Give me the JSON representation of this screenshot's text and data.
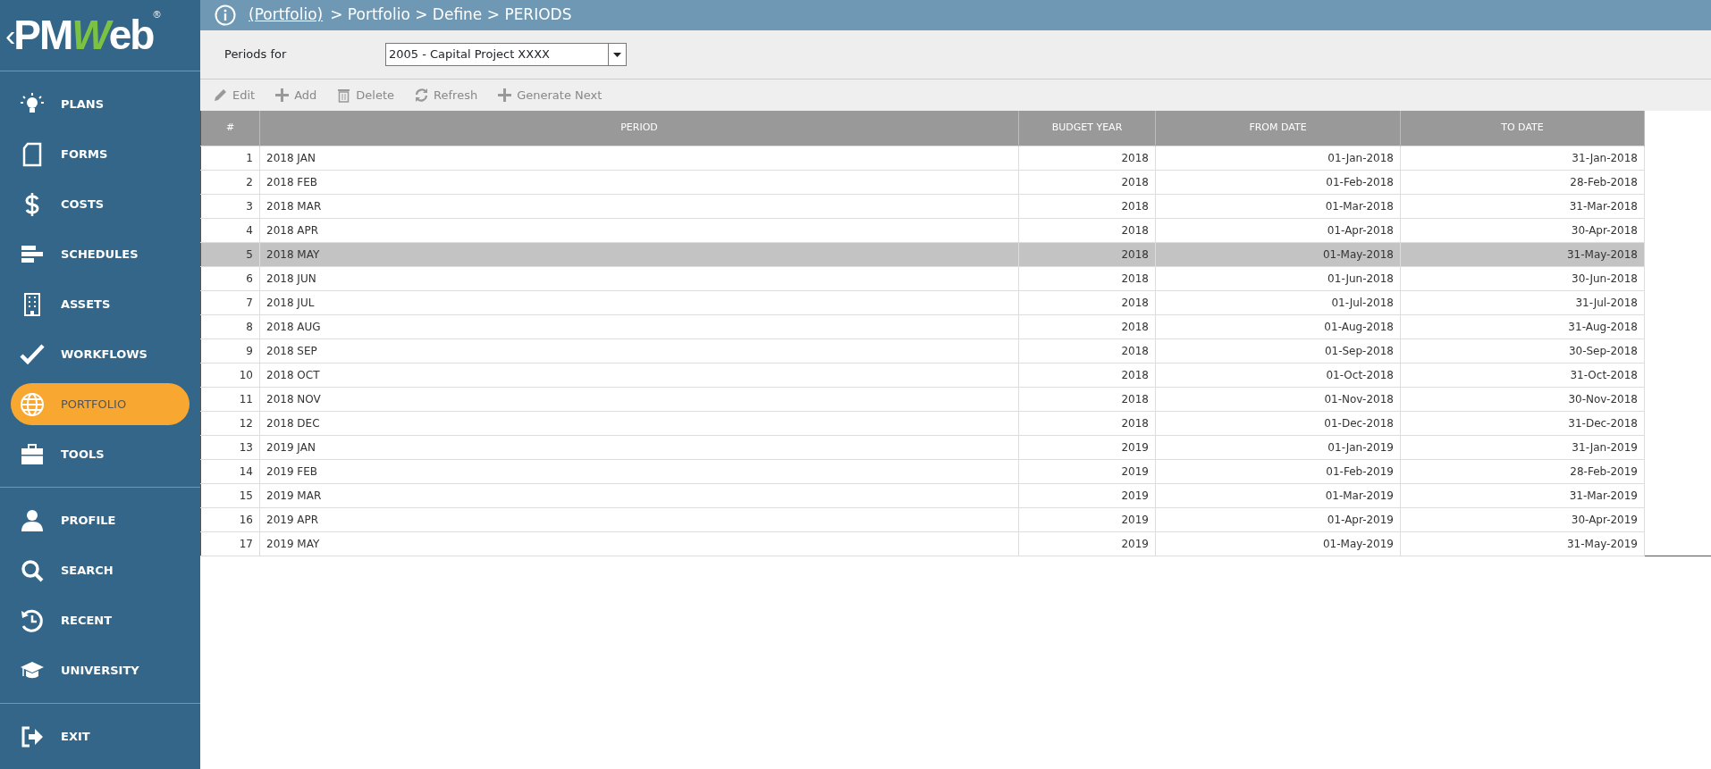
{
  "logo": {
    "prefix": "‹",
    "part_a": "PM",
    "part_b": "W",
    "part_c": "eb",
    "registered": "®"
  },
  "sidebar": {
    "groups": [
      {
        "items": [
          {
            "label": "PLANS",
            "selected": false
          },
          {
            "label": "FORMS",
            "selected": false
          },
          {
            "label": "COSTS",
            "selected": false
          },
          {
            "label": "SCHEDULES",
            "selected": false
          },
          {
            "label": "ASSETS",
            "selected": false
          },
          {
            "label": "WORKFLOWS",
            "selected": false
          },
          {
            "label": "PORTFOLIO",
            "selected": true
          },
          {
            "label": "TOOLS",
            "selected": false
          }
        ]
      },
      {
        "items": [
          {
            "label": "PROFILE",
            "selected": false
          },
          {
            "label": "SEARCH",
            "selected": false
          },
          {
            "label": "RECENT",
            "selected": false
          },
          {
            "label": "UNIVERSITY",
            "selected": false
          }
        ]
      },
      {
        "items": [
          {
            "label": "EXIT",
            "selected": false
          }
        ]
      }
    ]
  },
  "breadcrumb": {
    "link": "(Portfolio)",
    "path": "> Portfolio > Define > PERIODS"
  },
  "filter": {
    "label": "Periods for",
    "value": "2005 - Capital Project XXXX"
  },
  "toolbar": [
    {
      "label": "Edit"
    },
    {
      "label": "Add"
    },
    {
      "label": "Delete"
    },
    {
      "label": "Refresh"
    },
    {
      "label": "Generate Next"
    }
  ],
  "table": {
    "columns": [
      "#",
      "PERIOD",
      "BUDGET YEAR",
      "FROM DATE",
      "TO DATE"
    ],
    "rows": [
      {
        "cells": [
          "1",
          "2018 JAN",
          "2018",
          "01-Jan-2018",
          "31-Jan-2018"
        ],
        "selected": false
      },
      {
        "cells": [
          "2",
          "2018 FEB",
          "2018",
          "01-Feb-2018",
          "28-Feb-2018"
        ],
        "selected": false
      },
      {
        "cells": [
          "3",
          "2018 MAR",
          "2018",
          "01-Mar-2018",
          "31-Mar-2018"
        ],
        "selected": false
      },
      {
        "cells": [
          "4",
          "2018 APR",
          "2018",
          "01-Apr-2018",
          "30-Apr-2018"
        ],
        "selected": false
      },
      {
        "cells": [
          "5",
          "2018 MAY",
          "2018",
          "01-May-2018",
          "31-May-2018"
        ],
        "selected": true
      },
      {
        "cells": [
          "6",
          "2018 JUN",
          "2018",
          "01-Jun-2018",
          "30-Jun-2018"
        ],
        "selected": false
      },
      {
        "cells": [
          "7",
          "2018 JUL",
          "2018",
          "01-Jul-2018",
          "31-Jul-2018"
        ],
        "selected": false
      },
      {
        "cells": [
          "8",
          "2018 AUG",
          "2018",
          "01-Aug-2018",
          "31-Aug-2018"
        ],
        "selected": false
      },
      {
        "cells": [
          "9",
          "2018 SEP",
          "2018",
          "01-Sep-2018",
          "30-Sep-2018"
        ],
        "selected": false
      },
      {
        "cells": [
          "10",
          "2018 OCT",
          "2018",
          "01-Oct-2018",
          "31-Oct-2018"
        ],
        "selected": false
      },
      {
        "cells": [
          "11",
          "2018 NOV",
          "2018",
          "01-Nov-2018",
          "30-Nov-2018"
        ],
        "selected": false
      },
      {
        "cells": [
          "12",
          "2018 DEC",
          "2018",
          "01-Dec-2018",
          "31-Dec-2018"
        ],
        "selected": false
      },
      {
        "cells": [
          "13",
          "2019 JAN",
          "2019",
          "01-Jan-2019",
          "31-Jan-2019"
        ],
        "selected": false
      },
      {
        "cells": [
          "14",
          "2019 FEB",
          "2019",
          "01-Feb-2019",
          "28-Feb-2019"
        ],
        "selected": false
      },
      {
        "cells": [
          "15",
          "2019 MAR",
          "2019",
          "01-Mar-2019",
          "31-Mar-2019"
        ],
        "selected": false
      },
      {
        "cells": [
          "16",
          "2019 APR",
          "2019",
          "01-Apr-2019",
          "30-Apr-2019"
        ],
        "selected": false
      },
      {
        "cells": [
          "17",
          "2019 MAY",
          "2019",
          "01-May-2019",
          "31-May-2019"
        ],
        "selected": false
      }
    ]
  }
}
